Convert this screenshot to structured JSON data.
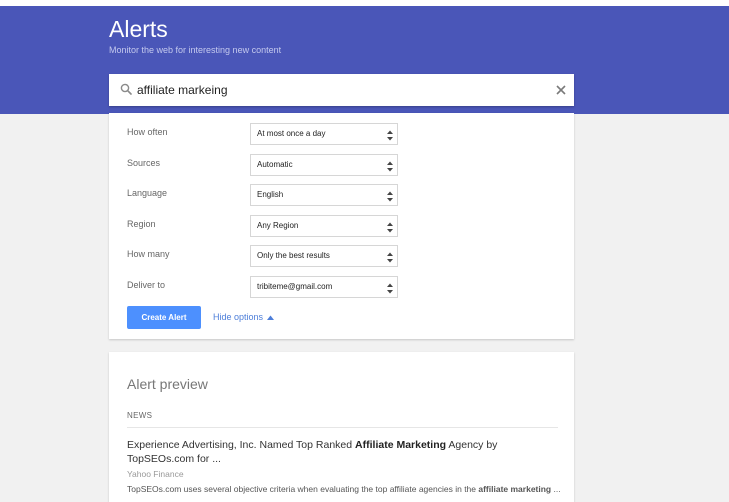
{
  "header": {
    "title": "Alerts",
    "subtitle": "Monitor the web for interesting new content"
  },
  "search": {
    "value": "affiliate markeing",
    "icon": "search-icon",
    "clear_icon": "close-icon"
  },
  "options": {
    "rows": [
      {
        "label": "How often",
        "value": "At most once a day"
      },
      {
        "label": "Sources",
        "value": "Automatic"
      },
      {
        "label": "Language",
        "value": "English"
      },
      {
        "label": "Region",
        "value": "Any Region"
      },
      {
        "label": "How many",
        "value": "Only the best results"
      },
      {
        "label": "Deliver to",
        "value": "tribiteme@gmail.com"
      }
    ],
    "create_label": "Create Alert",
    "hide_label": "Hide options"
  },
  "preview": {
    "title": "Alert preview",
    "section": "NEWS",
    "headline_parts": [
      {
        "text": "Experience Advertising, Inc. Named Top Ranked ",
        "bold": false
      },
      {
        "text": "Affiliate Marketing",
        "bold": true
      },
      {
        "text": " Agency by TopSEOs.com for ...",
        "bold": false
      }
    ],
    "source": "Yahoo Finance",
    "snippet_parts": [
      {
        "text": "TopSEOs.com uses several objective criteria when evaluating the top affiliate agencies in the ",
        "bold": false
      },
      {
        "text": "affiliate marketing",
        "bold": true
      },
      {
        "text": " ...",
        "bold": false
      }
    ]
  },
  "colors": {
    "header_bg": "#4a56b8",
    "button_bg": "#4d90fe",
    "link": "#4d7ed9"
  }
}
